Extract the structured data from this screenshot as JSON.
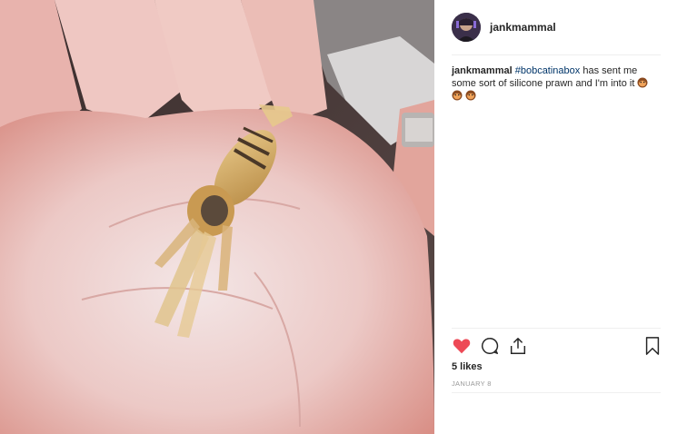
{
  "post": {
    "image_description_icon": "photo-hand-holding-silicone-prawn",
    "username": "jankmammal",
    "caption": {
      "user": "jankmammal",
      "hashtag": "#bobcatinabox",
      "text_part1": "has sent me some sort of silicone prawn and I'm into it",
      "emoji_name": "monkey-face-emoji"
    },
    "likes": "5 likes",
    "date": "JANUARY 8"
  },
  "colors": {
    "like_red": "#ed4956",
    "link_blue": "#003569",
    "text": "#262626",
    "muted": "#999999",
    "divider": "#efefef"
  }
}
